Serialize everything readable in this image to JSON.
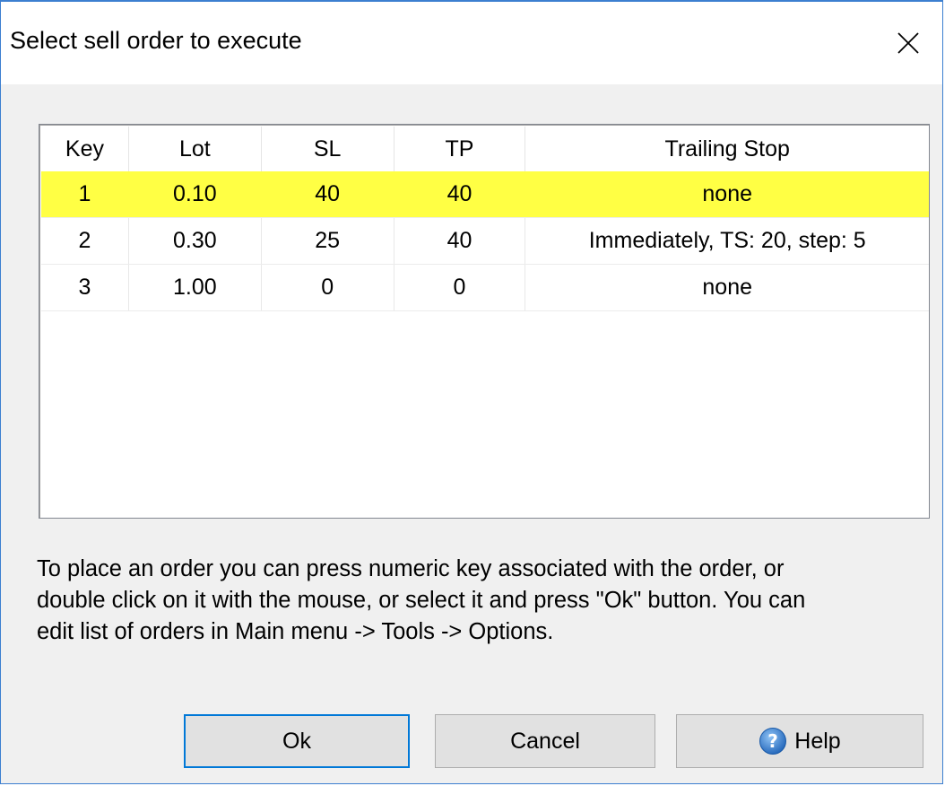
{
  "window": {
    "title": "Select sell order to execute"
  },
  "table": {
    "headers": [
      "Key",
      "Lot",
      "SL",
      "TP",
      "Trailing Stop"
    ],
    "rows": [
      {
        "key": "1",
        "lot": "0.10",
        "sl": "40",
        "tp": "40",
        "trailing_stop": "none",
        "selected": true
      },
      {
        "key": "2",
        "lot": "0.30",
        "sl": "25",
        "tp": "40",
        "trailing_stop": "Immediately, TS: 20, step: 5",
        "selected": false
      },
      {
        "key": "3",
        "lot": "1.00",
        "sl": "0",
        "tp": "0",
        "trailing_stop": "none",
        "selected": false
      }
    ],
    "selected_row_color": "#ffff44"
  },
  "info": {
    "lines": [
      "To place an order you can press numeric key associated with the order,  or",
      "double click on it with the mouse, or select it and press \"Ok\" button. You can",
      "edit list of orders in Main menu -> Tools -> Options."
    ]
  },
  "buttons": {
    "ok_label": "Ok",
    "cancel_label": "Cancel",
    "help_label": "Help"
  },
  "colors": {
    "window_border": "#3c7fd0",
    "default_button_border": "#0078d7",
    "help_icon": "#2f7fd4"
  }
}
